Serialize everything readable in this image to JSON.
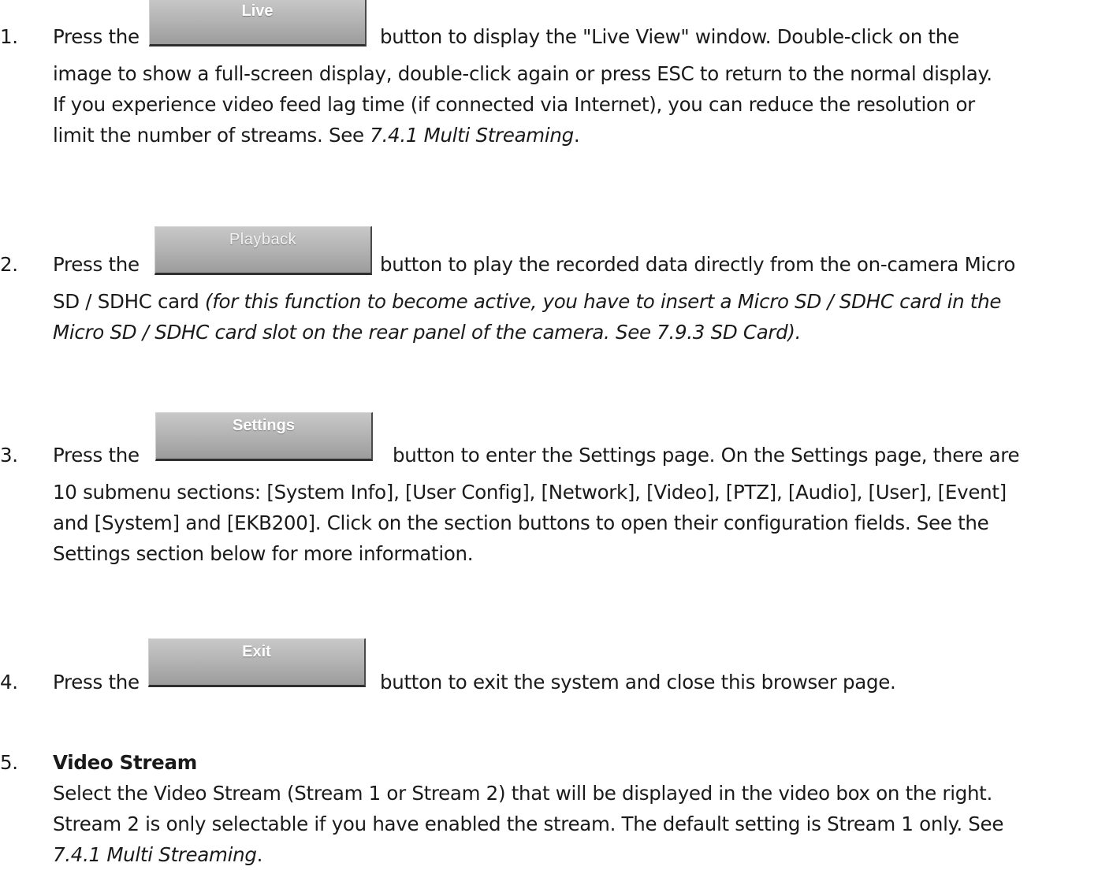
{
  "items": [
    {
      "number": "1.",
      "prefix": "Press the",
      "button_label": "Live",
      "line1_rest": "button to display the \"Live View\" window. Double-click on the",
      "line2": "image to show a full-screen display, double-click again or press ESC to return to the normal display.",
      "line3": "If you experience video feed lag time (if connected via Internet), you can reduce the resolution or",
      "line4_plain": "limit the number of streams. See ",
      "line4_italic": "7.4.1 Multi Streaming",
      "line4_end": "."
    },
    {
      "number": "2.",
      "prefix": "Press the",
      "button_label": "Playback",
      "line1_rest": "button to play the recorded data directly from the on-camera Micro",
      "line2_plain": "SD / SDHC card ",
      "line2_italic": "(for this function to become active, you have to insert a Micro SD / SDHC card in the",
      "line3_italic": "Micro SD / SDHC card slot on the rear panel of the camera. See 7.9.3 SD Card)."
    },
    {
      "number": "3.",
      "prefix": "Press the",
      "button_label": "Settings",
      "line1_rest": "button to enter the Settings page. On the Settings page, there are",
      "line2": "10 submenu sections: [System Info], [User Config], [Network], [Video], [PTZ], [Audio], [User], [Event]",
      "line3": "and [System] and [EKB200]. Click on the section buttons to open their configuration fields. See the",
      "line4": "Settings section below for more information."
    },
    {
      "number": "4.",
      "prefix": "Press the",
      "button_label": "Exit",
      "line1_rest": "button to exit the system and close this browser page."
    },
    {
      "number": "5.",
      "heading": "Video Stream",
      "line2": "Select the Video Stream (Stream 1 or Stream 2) that will be displayed in the video box on the right.",
      "line3": "Stream 2 is only selectable if you have enabled the stream. The default setting is Stream 1 only. See",
      "line4_italic": "7.4.1 Multi Streaming",
      "line4_end": "."
    }
  ]
}
